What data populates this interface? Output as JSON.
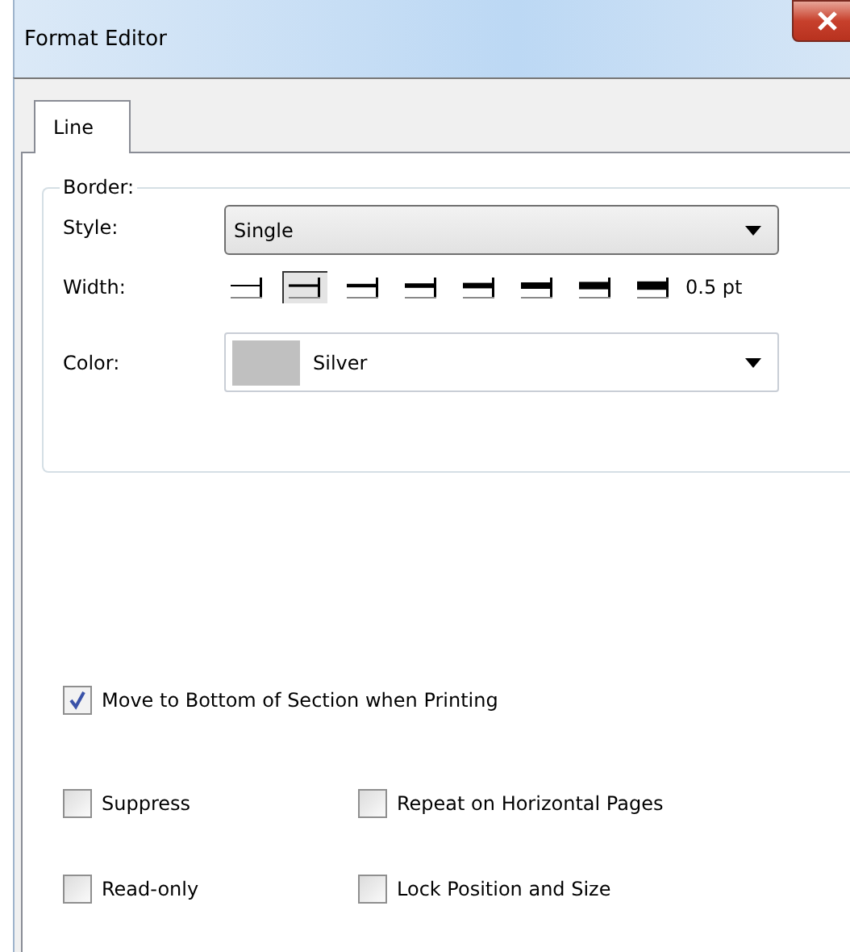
{
  "window": {
    "title": "Format Editor"
  },
  "tabs": [
    {
      "label": "Line",
      "selected": true
    }
  ],
  "border_group": {
    "title": "Border:",
    "style": {
      "label": "Style:",
      "value": "Single"
    },
    "width": {
      "label": "Width:",
      "options": [
        {
          "selected": false
        },
        {
          "selected": true
        },
        {
          "selected": false
        },
        {
          "selected": false
        },
        {
          "selected": false
        },
        {
          "selected": false
        },
        {
          "selected": false
        },
        {
          "selected": false
        }
      ],
      "reading": "0.5 pt"
    },
    "color": {
      "label": "Color:",
      "value": "Silver",
      "color": "#c0c0c0"
    }
  },
  "options": [
    {
      "label": "Move to Bottom of Section when Printing",
      "checked": true
    },
    {
      "label": "Suppress",
      "checked": false
    },
    {
      "label": "Repeat on Horizontal Pages",
      "checked": false
    },
    {
      "label": "Read-only",
      "checked": false
    },
    {
      "label": "Lock Position and Size",
      "checked": false
    }
  ]
}
